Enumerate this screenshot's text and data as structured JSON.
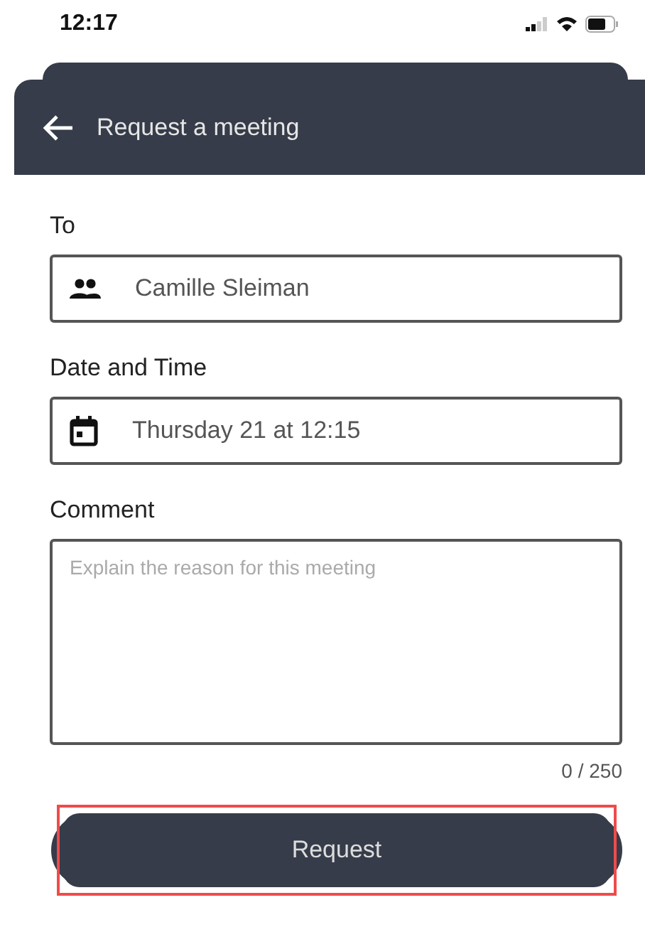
{
  "status_bar": {
    "time": "12:17"
  },
  "header": {
    "title": "Request a meeting"
  },
  "fields": [
    {
      "kind": "people",
      "label": "To",
      "value": "Camille Sleiman"
    },
    {
      "kind": "date",
      "label": "Date and Time",
      "value": "Thursday 21 at 12:15"
    }
  ],
  "comment": {
    "label": "Comment",
    "placeholder": "Explain the reason for this meeting",
    "counter": "0 / 250"
  },
  "submit": {
    "label": "Request",
    "highlighted": true
  }
}
